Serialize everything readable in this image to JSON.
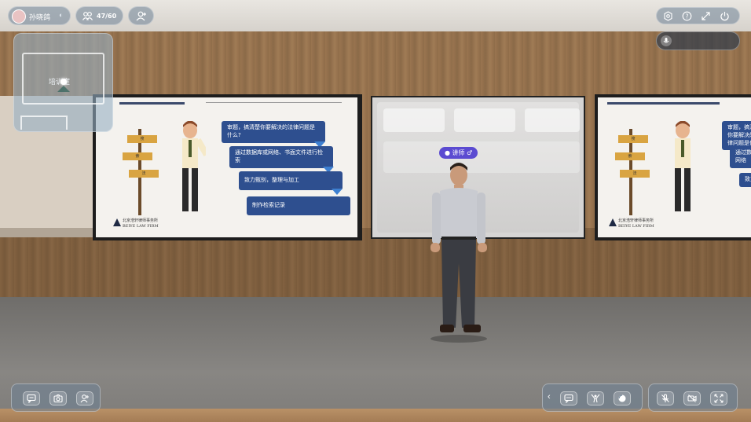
{
  "topbar": {
    "username": "孙晓鸽",
    "participants": "47/60"
  },
  "minimap": {
    "location_label": "培训室"
  },
  "speaker_tag": {
    "label": "讲师"
  },
  "slides": {
    "left": {
      "bubbles": [
        "审题，搞清楚你要解决的法律问题是什么?",
        "通过数据库或网络、书面文件进行检索",
        "致力甄别，整理与加工",
        "制作检索记录"
      ],
      "signs": [
        "搜",
        "索",
        "法"
      ],
      "firm_name": "北京浩轩律师事务所",
      "firm_en": "BEIYE LAW FIRM"
    },
    "right": {
      "bubbles": [
        "审题，搞清楚你要解决的法律问题是什么?",
        "通过数据库或网络",
        "致力"
      ],
      "signs": [
        "搜",
        "索",
        "法"
      ],
      "firm_name": "北京浩轩律师事务所",
      "firm_en": "BEIYE LAW FIRM"
    }
  },
  "icons": {
    "settings": "gear-icon",
    "help": "question-icon",
    "fullscreen": "expand-icon",
    "power": "power-icon",
    "chat": "chat-icon",
    "camera": "camera-icon",
    "contacts": "contacts-icon",
    "collapse": "chevron-left-icon",
    "message": "message-icon",
    "cheer": "cheer-icon",
    "like": "like-icon",
    "mic": "mic-off-icon",
    "video": "video-off-icon",
    "share": "share-screen-icon"
  },
  "colors": {
    "accent": "#5b4bd1",
    "bubble": "#2e4f8f",
    "hud": "#6e8296"
  }
}
